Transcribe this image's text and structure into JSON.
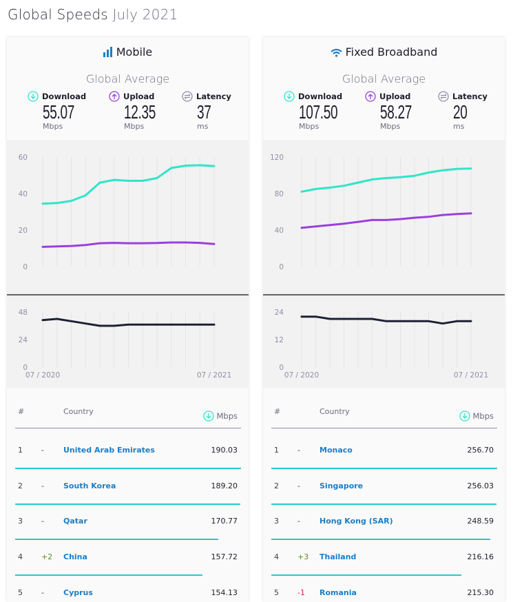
{
  "page": {
    "title": "Global Speeds",
    "subtitle": "July 2021"
  },
  "colors": {
    "download": "#2ee6c8",
    "upload": "#9b3fdd",
    "latency": "#1e2036",
    "bar": "#25cbcc",
    "brand": "#1a7ec7"
  },
  "panels": [
    {
      "key": "mobile",
      "title": "Mobile",
      "icon": "signal-bars-icon",
      "global_average_label": "Global Average",
      "metrics": [
        {
          "label": "Download",
          "value": "55.07",
          "unit": "Mbps",
          "icon": "download-icon"
        },
        {
          "label": "Upload",
          "value": "12.35",
          "unit": "Mbps",
          "icon": "upload-icon"
        },
        {
          "label": "Latency",
          "value": "37",
          "unit": "ms",
          "icon": "latency-icon"
        }
      ],
      "table": {
        "headers": {
          "rank": "#",
          "country": "Country",
          "speed": "Mbps"
        },
        "rows": [
          {
            "rank": "1",
            "change": "-",
            "country": "United Arab Emirates",
            "speed": "190.03"
          },
          {
            "rank": "2",
            "change": "-",
            "country": "South Korea",
            "speed": "189.20"
          },
          {
            "rank": "3",
            "change": "-",
            "country": "Qatar",
            "speed": "170.77"
          },
          {
            "rank": "4",
            "change": "+2",
            "country": "China",
            "speed": "157.72"
          },
          {
            "rank": "5",
            "change": "-",
            "country": "Cyprus",
            "speed": "154.13"
          }
        ]
      }
    },
    {
      "key": "fixed",
      "title": "Fixed Broadband",
      "icon": "wifi-icon",
      "global_average_label": "Global Average",
      "metrics": [
        {
          "label": "Download",
          "value": "107.50",
          "unit": "Mbps",
          "icon": "download-icon"
        },
        {
          "label": "Upload",
          "value": "58.27",
          "unit": "Mbps",
          "icon": "upload-icon"
        },
        {
          "label": "Latency",
          "value": "20",
          "unit": "ms",
          "icon": "latency-icon"
        }
      ],
      "table": {
        "headers": {
          "rank": "#",
          "country": "Country",
          "speed": "Mbps"
        },
        "rows": [
          {
            "rank": "1",
            "change": "-",
            "country": "Monaco",
            "speed": "256.70"
          },
          {
            "rank": "2",
            "change": "-",
            "country": "Singapore",
            "speed": "256.03"
          },
          {
            "rank": "3",
            "change": "-",
            "country": "Hong Kong (SAR)",
            "speed": "248.59"
          },
          {
            "rank": "4",
            "change": "+3",
            "country": "Thailand",
            "speed": "216.16"
          },
          {
            "rank": "5",
            "change": "-1",
            "country": "Romania",
            "speed": "215.30"
          }
        ]
      }
    }
  ],
  "chart_data": [
    {
      "type": "line",
      "panel": "mobile",
      "x_labels": [
        "07 / 2020",
        "07 / 2021"
      ],
      "ylim": [
        0,
        60
      ],
      "yticks": [
        0,
        20,
        40,
        60
      ],
      "grid": "vertical",
      "series": [
        {
          "key": "download",
          "values": [
            34.5,
            34.8,
            36,
            39,
            46,
            47.5,
            47,
            47,
            48.5,
            54,
            55.3,
            55.5,
            55.07
          ]
        },
        {
          "key": "upload",
          "values": [
            10.8,
            11,
            11.3,
            11.8,
            12.8,
            13,
            12.8,
            12.8,
            12.9,
            13.2,
            13.2,
            13,
            12.35
          ]
        }
      ]
    },
    {
      "type": "line",
      "panel": "mobile",
      "ylim": [
        0,
        48
      ],
      "yticks": [
        0,
        24,
        48
      ],
      "series": [
        {
          "key": "latency",
          "values": [
            41,
            42,
            40,
            38,
            36,
            36,
            37,
            37,
            37,
            37,
            37,
            37,
            37
          ]
        }
      ]
    },
    {
      "type": "line",
      "panel": "fixed",
      "x_labels": [
        "07 / 2020",
        "07 / 2021"
      ],
      "ylim": [
        0,
        120
      ],
      "yticks": [
        0,
        40,
        80,
        120
      ],
      "grid": "vertical",
      "series": [
        {
          "key": "download",
          "values": [
            82,
            85,
            86.5,
            88.5,
            92,
            95.5,
            97,
            98,
            99.5,
            103,
            105.5,
            107,
            107.5
          ]
        },
        {
          "key": "upload",
          "values": [
            42.5,
            44,
            45.5,
            47,
            49,
            51,
            51,
            52,
            53.5,
            54.5,
            56.5,
            57.5,
            58.27
          ]
        }
      ]
    },
    {
      "type": "line",
      "panel": "fixed",
      "ylim": [
        0,
        24
      ],
      "yticks": [
        0,
        12,
        24
      ],
      "series": [
        {
          "key": "latency",
          "values": [
            22,
            22,
            21,
            21,
            21,
            21,
            20,
            20,
            20,
            20,
            19,
            20,
            20
          ]
        }
      ]
    }
  ]
}
